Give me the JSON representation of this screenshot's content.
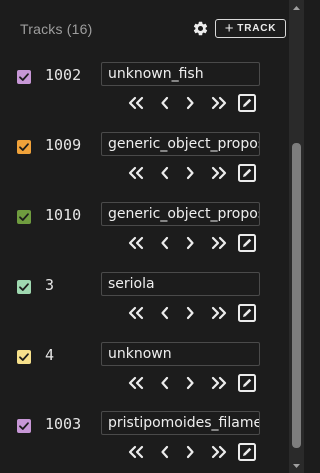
{
  "header": {
    "title": "Tracks (16)",
    "add_track_label": "TRACK",
    "settings_icon": "gear-icon",
    "add_icon": "plus-icon"
  },
  "tracks": [
    {
      "id": "1002",
      "name": "unknown_fish",
      "color": "#c797d6",
      "checked": true
    },
    {
      "id": "1009",
      "name": "generic_object_proposal",
      "color": "#f0a23a",
      "checked": true
    },
    {
      "id": "1010",
      "name": "generic_object_proposal",
      "color": "#6f9c3f",
      "checked": true
    },
    {
      "id": "3",
      "name": "seriola",
      "color": "#9fd8b0",
      "checked": true
    },
    {
      "id": "4",
      "name": "unknown",
      "color": "#f6e08b",
      "checked": true
    },
    {
      "id": "1003",
      "name": "pristipomoides_filamentosus",
      "color": "#c797d6",
      "checked": true
    }
  ],
  "controls": {
    "first_icon": "double-chevron-left-icon",
    "prev_icon": "chevron-left-icon",
    "next_icon": "chevron-right-icon",
    "last_icon": "double-chevron-right-icon",
    "edit_icon": "edit-icon"
  },
  "colors": {
    "background": "#1c1c1c",
    "text": "#e6e6e6",
    "muted_text": "#9e9e9e",
    "border": "#4a4a4a"
  }
}
